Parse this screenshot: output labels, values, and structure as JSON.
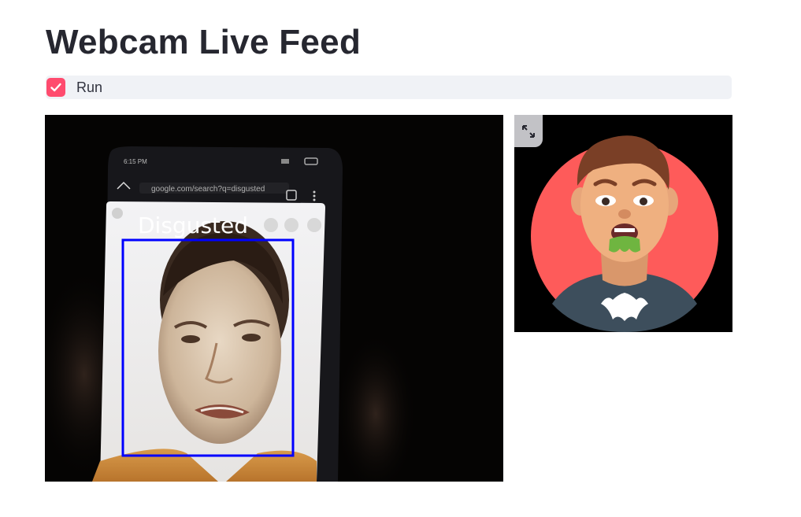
{
  "page": {
    "title": "Webcam Live Feed"
  },
  "run_toggle": {
    "label": "Run",
    "checked": true,
    "accent_color": "#ff4b6e"
  },
  "webcam_feed": {
    "emotion_label": "Disgusted",
    "box_color": "#0000ff"
  },
  "emoji_panel": {
    "emotion": "disgusted",
    "fullscreen_icon": "expand-icon"
  }
}
